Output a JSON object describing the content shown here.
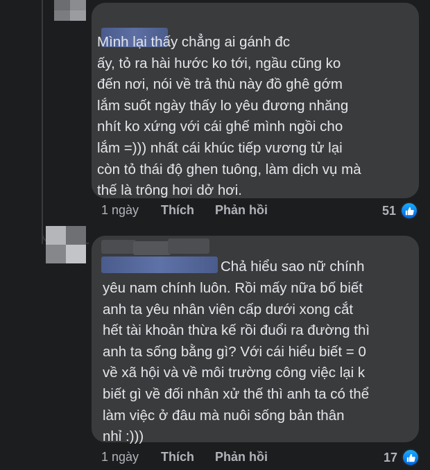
{
  "comments": [
    {
      "text": "Mình lại thấy chẳng ai gánh đc\nấy, tỏ ra hài hước ko tới, ngầu cũng ko\nđến nơi, nói về trả thù này đồ ghê gớm\nlắm suốt ngày thấy lo yêu đương nhăng\nnhít ko xứng với cái ghế mình ngồi cho\nlắm =))) nhất cái khúc tiếp vương tử lại\ncòn tỏ thái độ ghen tuông, làm dịch vụ mà\nthế là trông hơi dở hơi.",
      "time": "1 ngày",
      "like_label": "Thích",
      "reply_label": "Phản hồi",
      "reaction_count": "51"
    },
    {
      "text_first": "Chả hiểu sao nữ chính",
      "text_rest": "yêu nam chính luôn. Rồi mấy nữa bố biết\nanh ta yêu nhân viên cấp dưới xong cắt\nhết tài khoản thừa kế rồi đuổi ra đường thì\nanh ta sống bằng gì? Với cái hiểu biết = 0\nvề xã hội và về môi trường công việc lại k\nbiết gì về đối nhân xử thế thì anh ta có thể\nlàm việc ở đâu mà nuôi sống bản thân\nnhỉ :)))",
      "time": "1 ngày",
      "like_label": "Thích",
      "reply_label": "Phản hồi",
      "reaction_count": "17"
    }
  ],
  "icons": {
    "reaction": "like-icon"
  },
  "colors": {
    "background": "#1c1d1f",
    "bubble": "#3a3b3c",
    "text": "#e4e6eb",
    "muted": "#b0b3b8",
    "like": "#1877f2"
  }
}
